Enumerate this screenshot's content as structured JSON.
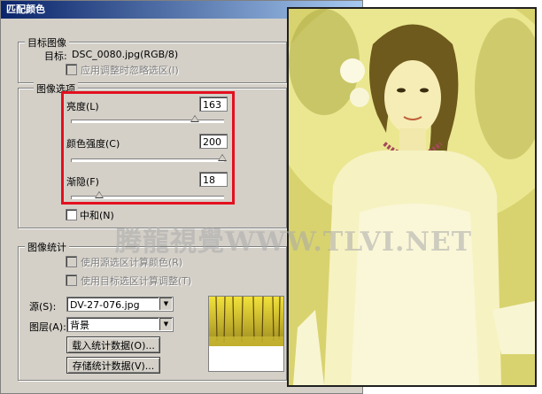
{
  "dialog": {
    "title": "匹配颜色",
    "target_group": {
      "label": "目标图像",
      "target_label": "目标:",
      "target_value": "DSC_0080.jpg(RGB/8)",
      "ignore_selection_label": "应用调整时忽略选区(I)"
    },
    "image_options": {
      "label": "图像选项",
      "brightness": {
        "label": "亮度(L)",
        "value": "163",
        "fraction": 0.815
      },
      "color_intensity": {
        "label": "颜色强度(C)",
        "value": "200",
        "fraction": 1.0
      },
      "fade": {
        "label": "渐隐(F)",
        "value": "18",
        "fraction": 0.18
      },
      "neutralize_label": "中和(N)"
    },
    "image_stats": {
      "label": "图像统计",
      "use_source_selection_label": "使用源选区计算颜色(R)",
      "use_target_selection_label": "使用目标选区计算调整(T)",
      "source_label": "源(S):",
      "source_value": "DV-27-076.jpg",
      "layer_label": "图层(A):",
      "layer_value": "背景",
      "load_button": "载入统计数据(O)...",
      "save_button": "存储统计数据(V)..."
    }
  },
  "watermark": "腾龍視覺WWW.TLVI.NET",
  "colors": {
    "highlight": "#e3101f",
    "dialog_bg": "#d4d0c8",
    "title_start": "#0a246a",
    "title_end": "#a6caf0"
  },
  "icons": {
    "dropdown": "chevron-down-icon"
  }
}
